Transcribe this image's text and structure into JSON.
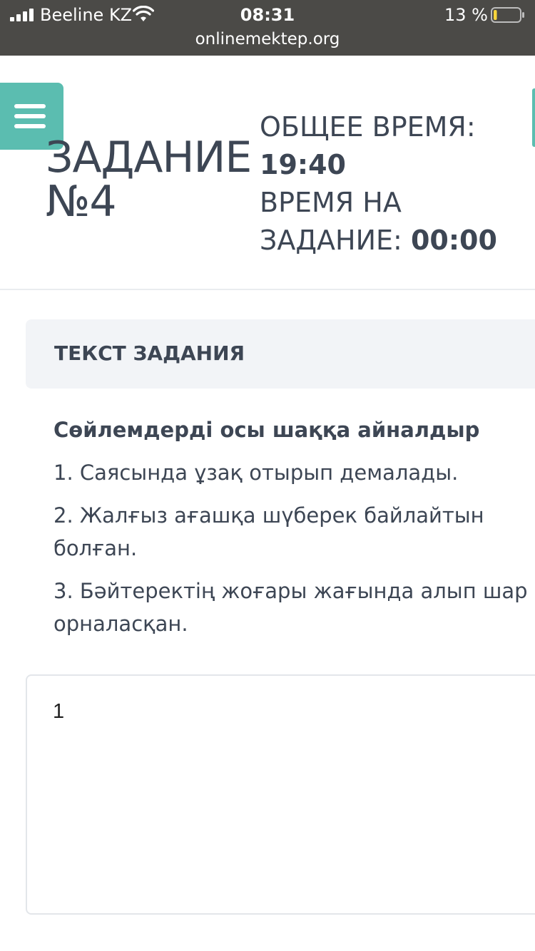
{
  "status_bar": {
    "carrier": "Beeline KZ",
    "time": "08:31",
    "battery_percent": "13 %",
    "battery_level": 0.13,
    "url": "onlinemektep.org"
  },
  "header": {
    "menu_icon": "hamburger-menu-icon",
    "task_title_line1": "ЗАДАНИЕ",
    "task_title_line2": "№4",
    "total_time_label": "ОБЩЕЕ ВРЕМЯ:",
    "total_time_value": "19:40",
    "task_time_label_line1": "ВРЕМЯ НА",
    "task_time_label_line2": "ЗАДАНИЕ:",
    "task_time_value": "00:00"
  },
  "task": {
    "panel_title": "ТЕКСТ ЗАДАНИЯ",
    "heading": "Сөйлемдерді осы шаққа айналдыр",
    "items": [
      "1. Саясында ұзақ отырып демалады.",
      "2. Жалғыз ағашқа шүберек байлайтын болған.",
      "3. Бәйтеректің жоғары жағында алып шар орналасқан."
    ]
  },
  "answer": {
    "value": "1"
  },
  "colors": {
    "accent": "#5bbdb0",
    "status_bar": "#4b4a47",
    "text": "#3d4654",
    "panel_bg": "#f2f4f7"
  }
}
